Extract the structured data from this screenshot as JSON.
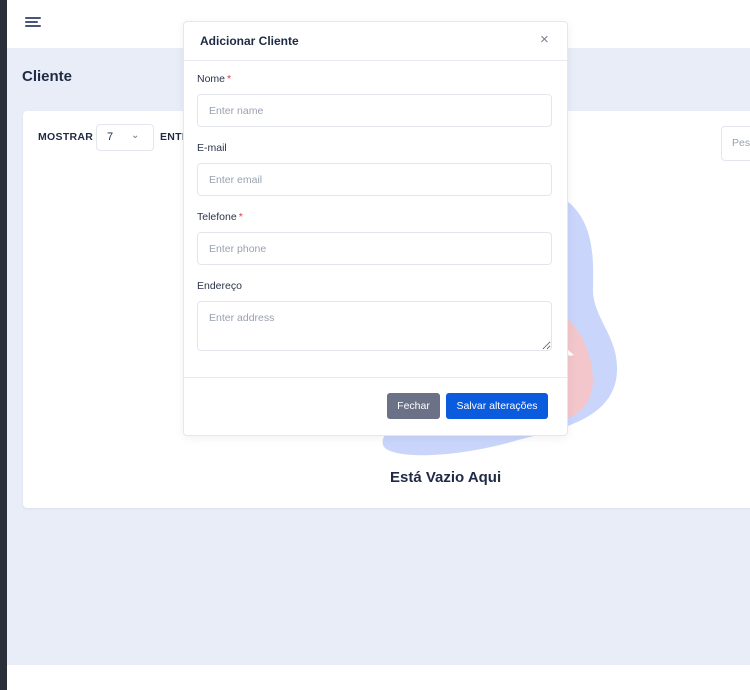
{
  "header": {
    "menu_icon": "menu-icon"
  },
  "page": {
    "title": "Cliente"
  },
  "table_controls": {
    "show_label": "MOSTRAR",
    "entries_value": "7",
    "entries_label": "ENTI",
    "search_placeholder": "Pes"
  },
  "empty_state": {
    "text": "Está Vazio Aqui"
  },
  "modal": {
    "title": "Adicionar Cliente",
    "fields": {
      "name": {
        "label": "Nome",
        "required": "*",
        "placeholder": "Enter name",
        "value": ""
      },
      "email": {
        "label": "E-mail",
        "placeholder": "Enter email",
        "value": ""
      },
      "phone": {
        "label": "Telefone",
        "required": "*",
        "placeholder": "Enter phone",
        "value": ""
      },
      "address": {
        "label": "Endereço",
        "placeholder": "Enter address",
        "value": ""
      }
    },
    "close_label": "Fechar",
    "save_label": "Salvar alterações"
  },
  "colors": {
    "primary": "#0a5bde",
    "secondary": "#6b7186",
    "required": "#e0344a",
    "background": "#e8edf8",
    "illustration_blue": "#c9d5fb",
    "illustration_pink": "#f3c6cc"
  }
}
